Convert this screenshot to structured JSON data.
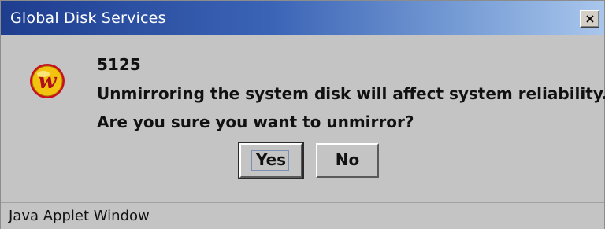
{
  "window": {
    "title": "Global Disk Services",
    "close_symbol": "×"
  },
  "dialog": {
    "icon": "app-logo-icon",
    "icon_letter": "w",
    "message_code": "5125",
    "message_line1": "Unmirroring the system disk will affect system reliability.",
    "message_line2": "Are you sure you want to unmirror?"
  },
  "buttons": {
    "yes_label": "Yes",
    "no_label": "No"
  },
  "status": {
    "text": "Java Applet Window"
  },
  "colors": {
    "titlebar_start": "#1e3d8f",
    "titlebar_end": "#a9c6ec",
    "dialog_background": "#c4c4c4",
    "icon_red": "#c8101e",
    "icon_gold": "#f2c40f"
  }
}
